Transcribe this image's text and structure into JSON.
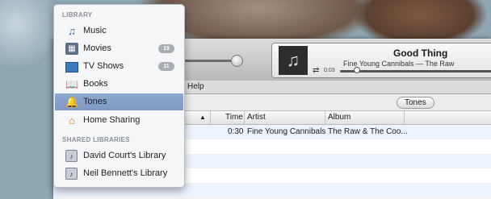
{
  "now_playing": {
    "title": "Good Thing",
    "subtitle": "Fine Young Cannibals — The Raw",
    "elapsed": "0:03",
    "progress_fraction": 0.1
  },
  "menubar": {
    "help_label": "Help"
  },
  "filter": {
    "tones_label": "Tones"
  },
  "table": {
    "headers": {
      "time": "Time",
      "artist": "Artist",
      "album": "Album"
    },
    "rows": [
      {
        "time": "0:30",
        "artist": "Fine Young Cannibals",
        "album": "The Raw & The Coo..."
      }
    ]
  },
  "sidebar": {
    "library_heading": "LIBRARY",
    "items": [
      {
        "label": "Music",
        "icon": "music-note-icon"
      },
      {
        "label": "Movies",
        "icon": "movies-icon",
        "badge": "19"
      },
      {
        "label": "TV Shows",
        "icon": "tv-icon",
        "badge": "11"
      },
      {
        "label": "Books",
        "icon": "book-icon"
      },
      {
        "label": "Tones",
        "icon": "bell-icon",
        "selected": true
      },
      {
        "label": "Home Sharing",
        "icon": "home-icon"
      }
    ],
    "shared_heading": "SHARED LIBRARIES",
    "shared": [
      {
        "label": "David Court's Library",
        "icon": "shared-library-icon"
      },
      {
        "label": "Neil Bennett's Library",
        "icon": "shared-library-icon"
      }
    ]
  },
  "colors": {
    "selection": "#7d97c2",
    "badge": "#a7acb5"
  }
}
